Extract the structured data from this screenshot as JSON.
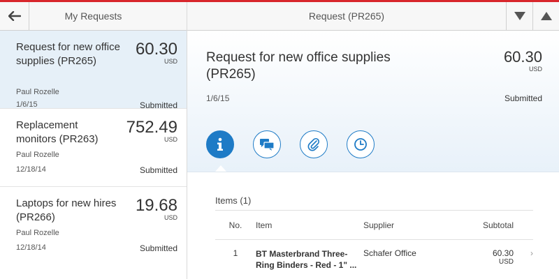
{
  "left_pane": {
    "title": "My Requests",
    "requests": [
      {
        "title": "Request for new office supplies (PR265)",
        "amount": "60.30",
        "currency": "USD",
        "requester": "Paul Rozelle",
        "date": "1/6/15",
        "status": "Submitted"
      },
      {
        "title": "Replacement monitors (PR263)",
        "amount": "752.49",
        "currency": "USD",
        "requester": "Paul Rozelle",
        "date": "12/18/14",
        "status": "Submitted"
      },
      {
        "title": "Laptops for new hires (PR266)",
        "amount": "19.68",
        "currency": "USD",
        "requester": "Paul Rozelle",
        "date": "12/18/14",
        "status": "Submitted"
      }
    ]
  },
  "right_pane": {
    "title": "Request (PR265)",
    "detail": {
      "title": "Request for new office supplies (PR265)",
      "amount": "60.30",
      "currency": "USD",
      "date": "1/6/15",
      "status": "Submitted"
    },
    "tabs": [
      {
        "icon": "info-icon"
      },
      {
        "icon": "comments-icon"
      },
      {
        "icon": "attachment-icon"
      },
      {
        "icon": "history-icon"
      }
    ],
    "items": {
      "header": "Items (1)",
      "columns": [
        "No.",
        "Item",
        "Supplier",
        "Subtotal"
      ],
      "rows": [
        {
          "no": "1",
          "item": "BT Masterbrand Three-Ring Binders - Red - 1\" ...",
          "supplier": "Schafer Office",
          "subtotal": "60.30",
          "currency": "USD"
        }
      ]
    }
  },
  "colors": {
    "accent": "#1e7bc6",
    "brand_red": "#d8262c",
    "selected_bg": "#e6f0f8"
  }
}
